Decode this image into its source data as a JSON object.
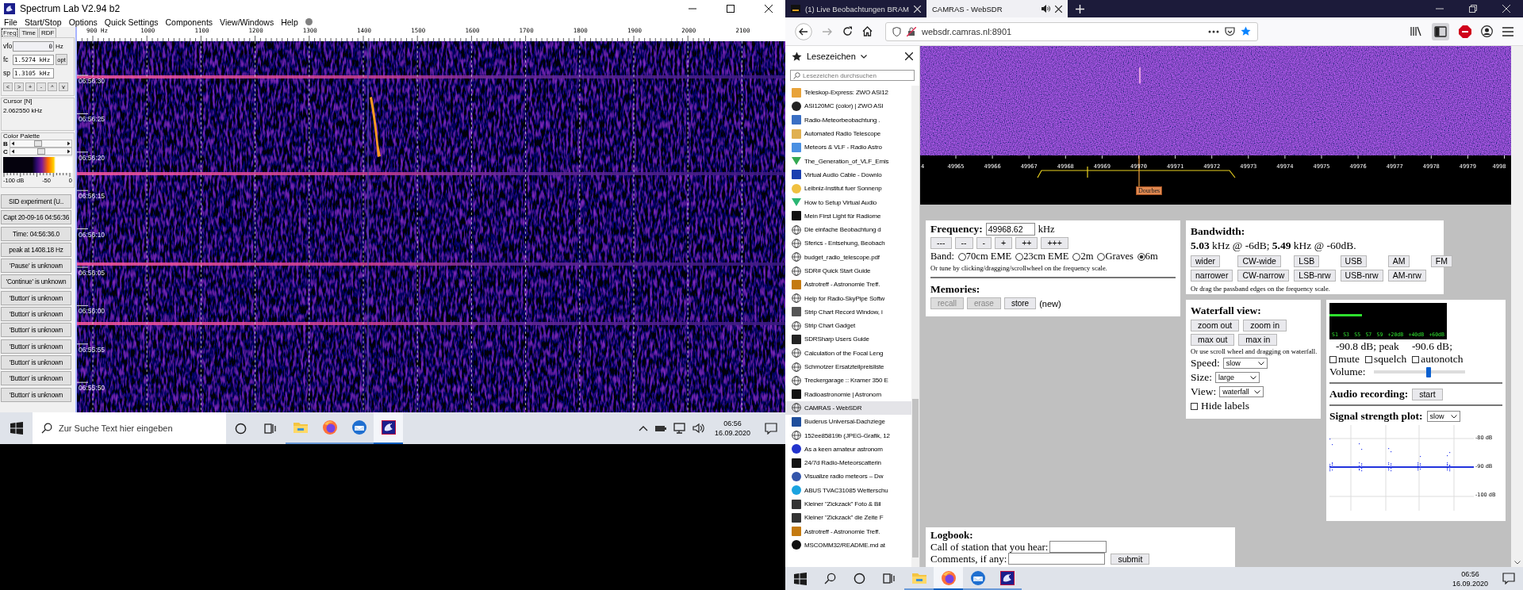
{
  "spectrum_lab": {
    "window": {
      "title": "Spectrum Lab V2.94 b2"
    },
    "menu": [
      "File",
      "Start/Stop",
      "Options",
      "Quick Settings",
      "Components",
      "View/Windows",
      "Help"
    ],
    "panel_tabs": [
      {
        "label": "Freq",
        "selected": true
      },
      {
        "label": "Time",
        "selected": false
      },
      {
        "label": "RDF",
        "selected": false
      }
    ],
    "fields": [
      {
        "label": "vfo",
        "value": "0",
        "unit": "Hz"
      },
      {
        "label": "fc",
        "value": "1.5274 kHz",
        "button": "opt"
      },
      {
        "label": "sp",
        "value": "1.3105 kHz"
      }
    ],
    "nav_buttons": [
      "<",
      ">",
      "+",
      "-",
      "^",
      "v"
    ],
    "cursor": {
      "title": "Cursor [N]",
      "value": "2.062550 kHz"
    },
    "color_palette": {
      "title": "Color Palette",
      "sliders": [
        {
          "label": "B",
          "level": 0.45
        },
        {
          "label": "C",
          "level": 0.5
        }
      ],
      "scale": [
        "-100 dB",
        "-50",
        "0"
      ]
    },
    "buttons": [
      "SID experiment (U..",
      "Capt 20-09-16 04:56:36",
      "Time:  04:56:36.0",
      "peak at 1408.18 Hz",
      "'Pause' is unknown",
      "'Continue' is unknown",
      "'Button' is unknown",
      "'Button' is unknown",
      "'Button' is unknown",
      "'Button' is unknown",
      "'Button' is unknown",
      "'Button' is unknown",
      "'Button' is unknown"
    ],
    "frequency_scale": [
      "900 Hz",
      "1000",
      "1100",
      "1200",
      "1300",
      "1400",
      "1500",
      "1600",
      "1700",
      "1800",
      "1900",
      "2000",
      "2100"
    ],
    "time_labels": [
      "06:56:30",
      "06:56:25",
      "06:56:20",
      "06:56:15",
      "06:56:10",
      "06:56:05",
      "06:56:00",
      "06:55:55",
      "06:55:50"
    ]
  },
  "taskbar_left": {
    "search": {
      "placeholder": "Zur Suche Text hier eingeben"
    },
    "apps": [
      {
        "kind": "explorer",
        "selected": false
      },
      {
        "kind": "firefox",
        "selected": false
      },
      {
        "kind": "thunderbird",
        "selected": false
      },
      {
        "kind": "spectrumlab",
        "selected": true
      }
    ],
    "clock": {
      "time": "06:56",
      "date": "16.09.2020"
    }
  },
  "browser": {
    "tabs": [
      {
        "title": "(1) Live Beobachtungen BRAM",
        "selected": false,
        "audio": false
      },
      {
        "title": "CAMRAS - WebSDR",
        "selected": true,
        "audio": true
      }
    ],
    "url": "websdr.camras.nl:8901",
    "bookmarked": true,
    "sidebar": {
      "title": "Lesezeichen",
      "search": {
        "placeholder": "Lesezeichen durchsuchen"
      },
      "items": [
        {
          "title": "Teleskop-Express: ZWO ASI12",
          "kind": "tile",
          "color": "#e8a33a",
          "selected": false
        },
        {
          "title": "ASI120MC (color) | ZWO ASI",
          "kind": "circle",
          "color": "#222222",
          "selected": false
        },
        {
          "title": "Radio-Meteorbeobachtung .",
          "kind": "tile",
          "color": "#3a6fc4",
          "selected": false
        },
        {
          "title": "Automated Radio Telescope",
          "kind": "tile",
          "color": "#e0b050",
          "selected": false
        },
        {
          "title": "Meteors & VLF - Radio Astro",
          "kind": "tile",
          "color": "#4a90e2",
          "selected": false
        },
        {
          "title": "The_Generation_of_VLF_Emis",
          "kind": "triangle",
          "color": "#34a853",
          "selected": false
        },
        {
          "title": "Virtual Audio Cable - Downlo",
          "kind": "tile",
          "color": "#1a3fb0",
          "selected": false
        },
        {
          "title": "Leibniz-Institut fuer Sonnenp",
          "kind": "circle",
          "color": "#f0c040",
          "selected": false
        },
        {
          "title": "How to Setup Virtual Audio",
          "kind": "triangle",
          "color": "#2bb673",
          "selected": false
        },
        {
          "title": "Mein First Light für Radiome",
          "kind": "tile",
          "color": "#111111",
          "selected": false
        },
        {
          "title": "Die einfache Beobachtung d",
          "kind": "globe",
          "selected": false
        },
        {
          "title": "Sferics - Entsehung, Beobach",
          "kind": "globe",
          "selected": false
        },
        {
          "title": "budget_radio_telescope.pdf",
          "kind": "globe",
          "selected": false
        },
        {
          "title": "SDR# Quick Start Guide",
          "kind": "globe",
          "selected": false
        },
        {
          "title": "Astrotreff - Astronomie Treff.",
          "kind": "tile",
          "color": "#c47a10",
          "selected": false
        },
        {
          "title": "Help for Radio-SkyPipe Softw",
          "kind": "globe",
          "selected": false
        },
        {
          "title": "Strip Chart Record Window, i",
          "kind": "tile",
          "color": "#555555",
          "selected": false
        },
        {
          "title": "Strip Chart Gadget",
          "kind": "globe",
          "selected": false
        },
        {
          "title": "SDRSharp Users Guide",
          "kind": "tile",
          "color": "#222222",
          "selected": false
        },
        {
          "title": "Calculation of the Focal Leng",
          "kind": "globe",
          "selected": false
        },
        {
          "title": "Schmotzer Ersatzteilpreisliste",
          "kind": "globe",
          "selected": false
        },
        {
          "title": "Treckergarage :: Kramer 350 E",
          "kind": "globe",
          "selected": false
        },
        {
          "title": "Radioastronomie | Astronom",
          "kind": "tile",
          "color": "#111111",
          "selected": false
        },
        {
          "title": "CAMRAS - WebSDR",
          "kind": "globe",
          "selected": true
        },
        {
          "title": "Buderus Universal-Dachziege",
          "kind": "tile",
          "color": "#1f4e9c",
          "selected": false
        },
        {
          "title": "152ee85819b (JPEG-Grafik, 12",
          "kind": "globe",
          "selected": false
        },
        {
          "title": "As a keen amateur astronom",
          "kind": "circle",
          "color": "#2233cc",
          "selected": false
        },
        {
          "title": "24/7d Radio-Meteorscatterin",
          "kind": "tile",
          "color": "#111111",
          "selected": false
        },
        {
          "title": "Visualize radio meteors – Dw",
          "kind": "circle",
          "color": "#3355aa",
          "selected": false
        },
        {
          "title": "ABUS TVAC31085 Wetterschu",
          "kind": "circle",
          "color": "#1aa3e0",
          "selected": false
        },
        {
          "title": "Kleiner \"Zickzack\" Foto & Bil",
          "kind": "tile",
          "color": "#333333",
          "selected": false
        },
        {
          "title": "Kleiner \"Zickzack\" die Zeite F",
          "kind": "tile",
          "color": "#333333",
          "selected": false
        },
        {
          "title": "Astrotreff - Astronomie Treff.",
          "kind": "tile",
          "color": "#c47a10",
          "selected": false
        },
        {
          "title": "MSCOMM32/README.md at",
          "kind": "circle",
          "color": "#111111",
          "selected": false
        }
      ]
    }
  },
  "websdr": {
    "scale_labels": [
      "4",
      "49965",
      "49966",
      "49967",
      "49968",
      "49969",
      "49970",
      "49971",
      "49972",
      "49973",
      "49974",
      "49975",
      "49976",
      "49977",
      "49978",
      "49979",
      "4998"
    ],
    "station_label": "Dourbes",
    "frequency": {
      "title": "Frequency:",
      "value": "49968.62",
      "unit": "kHz",
      "step_buttons": [
        "---",
        "--",
        "-",
        "+",
        "++",
        "+++"
      ],
      "band_label": "Band:",
      "bands": [
        {
          "label": "70cm EME",
          "selected": false
        },
        {
          "label": "23cm EME",
          "selected": false
        },
        {
          "label": "2m",
          "selected": false
        },
        {
          "label": "Graves",
          "selected": false
        },
        {
          "label": "6m",
          "selected": true
        }
      ],
      "hint": "Or tune by clicking/dragging/scrollwheel on the frequency scale.",
      "memories_title": "Memories:",
      "memory_buttons": [
        {
          "label": "recall",
          "disabled": true
        },
        {
          "label": "erase",
          "disabled": true
        },
        {
          "label": "store",
          "disabled": false
        }
      ],
      "memory_note": "(new)"
    },
    "bandwidth": {
      "title": "Bandwidth:",
      "value": "**5.03** kHz @ -6dB; **5.49** kHz @ -60dB.",
      "rows": [
        [
          "wider",
          "CW-wide",
          "LSB",
          "USB",
          "AM",
          "FM"
        ],
        [
          "narrower",
          "CW-narrow",
          "LSB-nrw",
          "USB-nrw",
          "AM-nrw"
        ]
      ],
      "hint": "Or drag the passband edges on the frequency scale."
    },
    "waterfall_view": {
      "title": "Waterfall view:",
      "rows": [
        [
          "zoom out",
          "zoom in"
        ],
        [
          "max out",
          "max in"
        ]
      ],
      "hint": "Or use scroll wheel and dragging on waterfall.",
      "selects": [
        {
          "label": "Speed:",
          "value": "slow"
        },
        {
          "label": "Size:",
          "value": "large"
        },
        {
          "label": "View:",
          "value": "waterfall"
        }
      ],
      "hide_labels": {
        "label": "Hide labels",
        "checked": false
      }
    },
    "audio": {
      "smeter": {
        "level": 0.28,
        "labels": [
          "S1",
          "S3",
          "S5",
          "S7",
          "S9",
          "+20dB",
          "+40dB",
          "+60dB"
        ]
      },
      "reading": "-90.8 dB; peak",
      "peak": "-90.6 dB;",
      "checkboxes": [
        {
          "label": "mute",
          "checked": false
        },
        {
          "label": "squelch",
          "checked": false
        },
        {
          "label": "autonotch",
          "checked": false
        }
      ],
      "volume": {
        "label": "Volume:",
        "level": 0.6
      },
      "recording": {
        "title": "Audio recording:",
        "button": "start"
      },
      "plot": {
        "title": "Signal strength plot:",
        "select": "slow",
        "ticks": [
          "-80 dB",
          "-90 dB",
          "-100 dB"
        ]
      }
    },
    "logbook": {
      "title": "Logbook:",
      "fields": [
        {
          "label": "Call of station that you hear:"
        },
        {
          "label": "Comments, if any:"
        }
      ],
      "button": "submit"
    }
  },
  "taskbar_right": {
    "apps": [
      {
        "kind": "explorer",
        "selected": false
      },
      {
        "kind": "firefox",
        "selected": true
      },
      {
        "kind": "thunderbird",
        "selected": false
      },
      {
        "kind": "spectrumlab",
        "selected": false
      }
    ],
    "clock": {
      "time": "06:56",
      "date": "16.09.2020"
    }
  }
}
